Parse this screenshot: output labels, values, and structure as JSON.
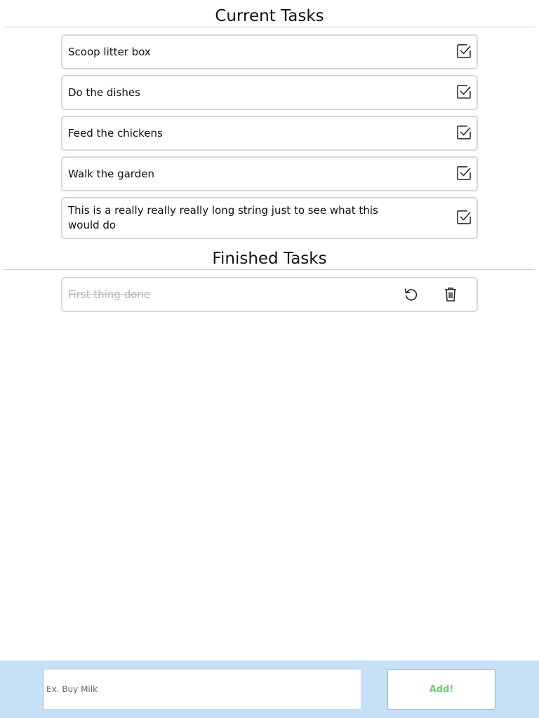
{
  "current": {
    "title": "Current Tasks",
    "tasks": [
      {
        "label": "Scoop litter box"
      },
      {
        "label": "Do the dishes"
      },
      {
        "label": "Feed the chickens"
      },
      {
        "label": "Walk the garden"
      },
      {
        "label": "This is a really really really long string just to see what this would do"
      }
    ]
  },
  "finished": {
    "title": "Finished Tasks",
    "tasks": [
      {
        "label": "First thing done"
      }
    ]
  },
  "add_form": {
    "input_value": "",
    "placeholder": "Ex. Buy Milk",
    "button_label": "Add!"
  },
  "colors": {
    "bottom_bar": "#c5e0f7",
    "add_button_text": "#6ecb6e",
    "finished_text": "#b5b5b5"
  },
  "icons": {
    "complete": "checkbox-checked-icon",
    "undo": "undo-icon",
    "delete": "trash-icon"
  }
}
